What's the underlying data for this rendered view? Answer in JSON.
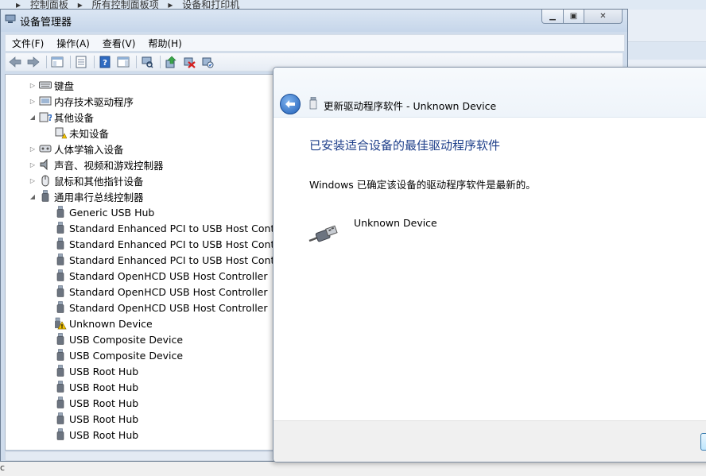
{
  "background": {
    "breadcrumb": [
      "控制面板",
      "所有控制面板项",
      "设备和打印机"
    ],
    "bottom_fragment": "c"
  },
  "device_manager": {
    "title": "设备管理器",
    "menu": [
      "文件(F)",
      "操作(A)",
      "查看(V)",
      "帮助(H)"
    ],
    "tree": [
      {
        "label": "键盘",
        "level": 1,
        "expander": "▷",
        "icon": "keyboard-icon"
      },
      {
        "label": "内存技术驱动程序",
        "level": 1,
        "expander": "▷",
        "icon": "memory-device-icon"
      },
      {
        "label": "其他设备",
        "level": 1,
        "expander": "◢",
        "icon": "unknown-device-category-icon"
      },
      {
        "label": "未知设备",
        "level": 2,
        "expander": "",
        "icon": "unknown-device-icon"
      },
      {
        "label": "人体学输入设备",
        "level": 1,
        "expander": "▷",
        "icon": "hid-icon"
      },
      {
        "label": "声音、视频和游戏控制器",
        "level": 1,
        "expander": "▷",
        "icon": "speaker-icon"
      },
      {
        "label": "鼠标和其他指针设备",
        "level": 1,
        "expander": "▷",
        "icon": "mouse-icon"
      },
      {
        "label": "通用串行总线控制器",
        "level": 1,
        "expander": "◢",
        "icon": "usb-plug-icon"
      },
      {
        "label": "Generic USB Hub",
        "level": 2,
        "expander": "",
        "icon": "usb-plug-icon"
      },
      {
        "label": "Standard Enhanced PCI to USB Host Controller",
        "level": 2,
        "expander": "",
        "icon": "usb-plug-icon"
      },
      {
        "label": "Standard Enhanced PCI to USB Host Controller",
        "level": 2,
        "expander": "",
        "icon": "usb-plug-icon"
      },
      {
        "label": "Standard Enhanced PCI to USB Host Controller",
        "level": 2,
        "expander": "",
        "icon": "usb-plug-icon"
      },
      {
        "label": "Standard OpenHCD USB Host Controller",
        "level": 2,
        "expander": "",
        "icon": "usb-plug-icon"
      },
      {
        "label": "Standard OpenHCD USB Host Controller",
        "level": 2,
        "expander": "",
        "icon": "usb-plug-icon"
      },
      {
        "label": "Standard OpenHCD USB Host Controller",
        "level": 2,
        "expander": "",
        "icon": "usb-plug-icon"
      },
      {
        "label": "Unknown Device",
        "level": 2,
        "expander": "",
        "icon": "warning-icon"
      },
      {
        "label": "USB Composite Device",
        "level": 2,
        "expander": "",
        "icon": "usb-plug-icon"
      },
      {
        "label": "USB Composite Device",
        "level": 2,
        "expander": "",
        "icon": "usb-plug-icon"
      },
      {
        "label": "USB Root Hub",
        "level": 2,
        "expander": "",
        "icon": "usb-plug-icon"
      },
      {
        "label": "USB Root Hub",
        "level": 2,
        "expander": "",
        "icon": "usb-plug-icon"
      },
      {
        "label": "USB Root Hub",
        "level": 2,
        "expander": "",
        "icon": "usb-plug-icon"
      },
      {
        "label": "USB Root Hub",
        "level": 2,
        "expander": "",
        "icon": "usb-plug-icon"
      },
      {
        "label": "USB Root Hub",
        "level": 2,
        "expander": "",
        "icon": "usb-plug-icon"
      }
    ]
  },
  "dialog": {
    "title": "更新驱动程序软件 - Unknown Device",
    "heading": "已安装适合设备的最佳驱动程序软件",
    "description": "Windows 已确定该设备的驱动程序软件是最新的。",
    "device_name": "Unknown Device"
  },
  "colors": {
    "heading": "#1e3f8a",
    "window_frame": "#cfdcec",
    "warning": "#f5c400"
  }
}
